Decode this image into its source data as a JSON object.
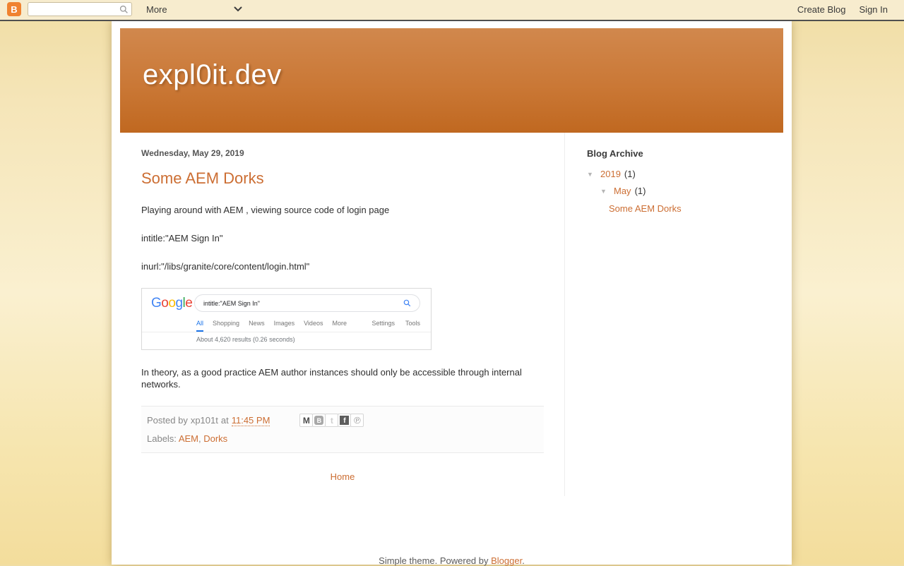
{
  "colors": {
    "accent": "#cc6e33",
    "navbar_bg": "#f7ecce",
    "header_gradient_top": "#d1884d",
    "header_gradient_bottom": "#c06820",
    "blogger_orange": "#f0822f",
    "google_blue": "#4285f4",
    "google_active_tab": "#1a73e8"
  },
  "navbar": {
    "more_label": "More",
    "create_blog_label": "Create Blog",
    "sign_in_label": "Sign In",
    "search_value": "",
    "icons": [
      "blogger-logo-icon",
      "search-icon",
      "chevron-down-icon"
    ]
  },
  "header": {
    "title": "expl0it.dev"
  },
  "post": {
    "date": "Wednesday, May 29, 2019",
    "title": "Some AEM Dorks",
    "intro_paragraphs": [
      "Playing around with AEM , viewing source code of login page",
      "intitle:\"AEM Sign In\"",
      "inurl:\"/libs/granite/core/content/login.html\""
    ],
    "outro_paragraph": "In theory, as a good practice AEM author instances should only be accessible through internal networks.",
    "meta": {
      "posted_by": "Posted by",
      "author": "xp101t",
      "at_word": "at",
      "time": "11:45 PM",
      "labels_title": "Labels:",
      "labels": [
        {
          "label": "AEM",
          "sep": ", "
        },
        {
          "label": "Dorks",
          "sep": ""
        }
      ],
      "share_icons": [
        {
          "name": "email-icon",
          "glyph": "M",
          "cls": "email"
        },
        {
          "name": "blogthis-icon",
          "glyph": "B",
          "cls": "blogthis"
        },
        {
          "name": "twitter-icon",
          "glyph": "t",
          "cls": "twitter"
        },
        {
          "name": "facebook-icon",
          "glyph": "f",
          "cls": "facebook"
        },
        {
          "name": "pinterest-icon",
          "glyph": "℗",
          "cls": "pinterest"
        }
      ]
    }
  },
  "google_screenshot": {
    "logo_letters": [
      {
        "ch": "G",
        "color": "#4285F4"
      },
      {
        "ch": "o",
        "color": "#EA4335"
      },
      {
        "ch": "o",
        "color": "#FBBC05"
      },
      {
        "ch": "g",
        "color": "#4285F4"
      },
      {
        "ch": "l",
        "color": "#34A853"
      },
      {
        "ch": "e",
        "color": "#EA4335"
      }
    ],
    "query": "intitle:\"AEM Sign In\"",
    "tabs": [
      {
        "label": "All",
        "cls": "active"
      },
      {
        "label": "Shopping",
        "cls": ""
      },
      {
        "label": "News",
        "cls": ""
      },
      {
        "label": "Images",
        "cls": ""
      },
      {
        "label": "Videos",
        "cls": ""
      },
      {
        "label": "More",
        "cls": ""
      }
    ],
    "right_tabs": [
      {
        "label": "Settings"
      },
      {
        "label": "Tools"
      }
    ],
    "stats": "About 4,620 results (0.26 seconds)"
  },
  "home_link_label": "Home",
  "sidebar": {
    "title": "Blog Archive",
    "year": {
      "toggle": "▼",
      "label": "2019",
      "count": "(1)"
    },
    "month": {
      "toggle": "▼",
      "label": "May",
      "count": "(1)"
    },
    "post_link": "Some AEM Dorks"
  },
  "footer": {
    "prefix": "Simple theme. Powered by ",
    "link": "Blogger",
    "suffix": "."
  }
}
